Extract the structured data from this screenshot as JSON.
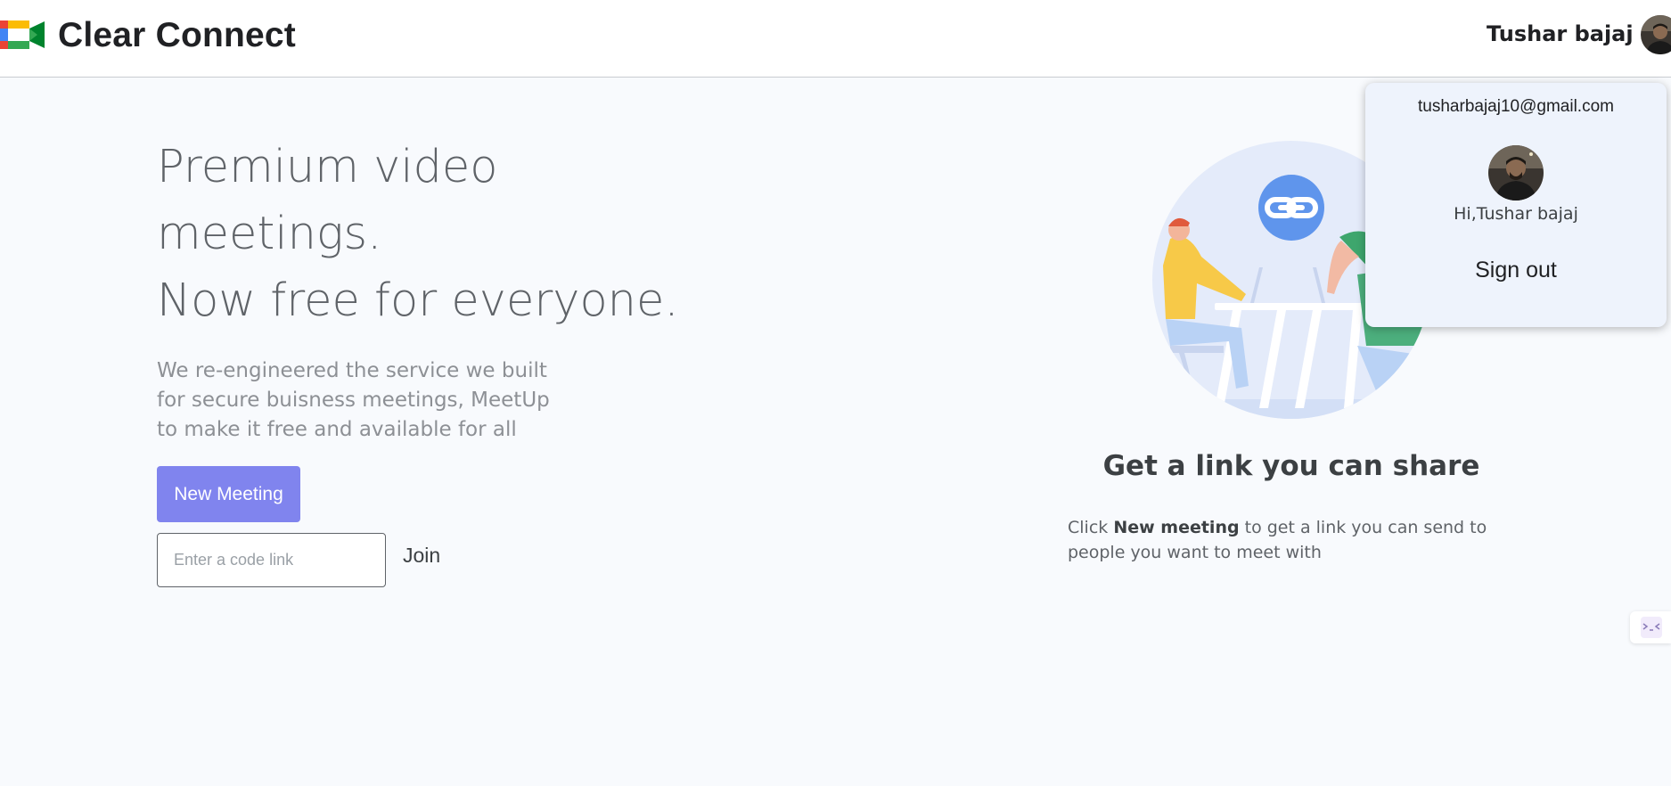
{
  "app": {
    "brand": "Clear Connect",
    "user_name": "Tushar bajaj",
    "icons": {
      "logo": "meet-camera-logo-icon",
      "avatar": "user-avatar",
      "side_widget": "collapse-widget-icon"
    }
  },
  "hero": {
    "title_lines": [
      "Premium video",
      "meetings.",
      "Now free for everyone."
    ],
    "description_lines": [
      "We re-engineered the service we built",
      "for secure buisness meetings, MeetUp",
      "to make it free and available for all"
    ],
    "new_meeting_label": "New Meeting",
    "code_placeholder": "Enter a code link",
    "join_label": "Join"
  },
  "share": {
    "title": "Get a link you can share",
    "desc_prefix": "Click ",
    "desc_bold": "New meeting",
    "desc_suffix": " to get a link you can send to people you want to meet with"
  },
  "account_menu": {
    "email": "tusharbajaj10@gmail.com",
    "greeting": "Hi,Tushar bajaj",
    "sign_out_label": "Sign out"
  },
  "colors": {
    "accent": "#8084ee",
    "link_circle": "#5f95ec",
    "dropdown_bg": "#eef3fc",
    "page_bg": "#f8fafd"
  }
}
